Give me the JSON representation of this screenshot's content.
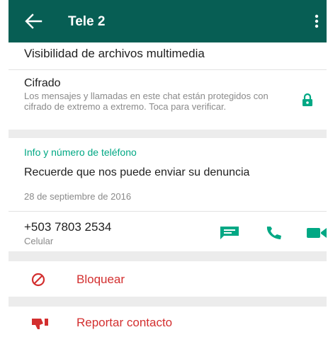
{
  "colors": {
    "appbar": "#075e54",
    "accent": "#00a884",
    "danger": "#d32f2f",
    "primary_text": "#1f1f1f",
    "secondary_text": "#8a8a8a",
    "section_background": "#ececec"
  },
  "appbar": {
    "title": "Tele 2",
    "back_icon": "arrow-back-icon",
    "menu_icon": "more-vertical-icon"
  },
  "media": {
    "label": "Visibilidad de archivos multimedia"
  },
  "encryption": {
    "title": "Cifrado",
    "description": "Los mensajes y llamadas en este chat están protegidos con cifrado de extremo a extremo. Toca para verificar.",
    "icon": "lock-icon"
  },
  "info": {
    "heading": "Info y número de teléfono",
    "status": "Recuerde que nos puede enviar su denuncia",
    "status_date": "28 de septiembre de 2016",
    "phone": "+503 7803 2534",
    "phone_type": "Celular",
    "action_icons": [
      "message-icon",
      "phone-call-icon",
      "video-call-icon"
    ]
  },
  "actions": {
    "block": {
      "label": "Bloquear",
      "icon": "block-icon"
    },
    "report": {
      "label": "Reportar contacto",
      "icon": "thumbs-down-icon"
    }
  }
}
